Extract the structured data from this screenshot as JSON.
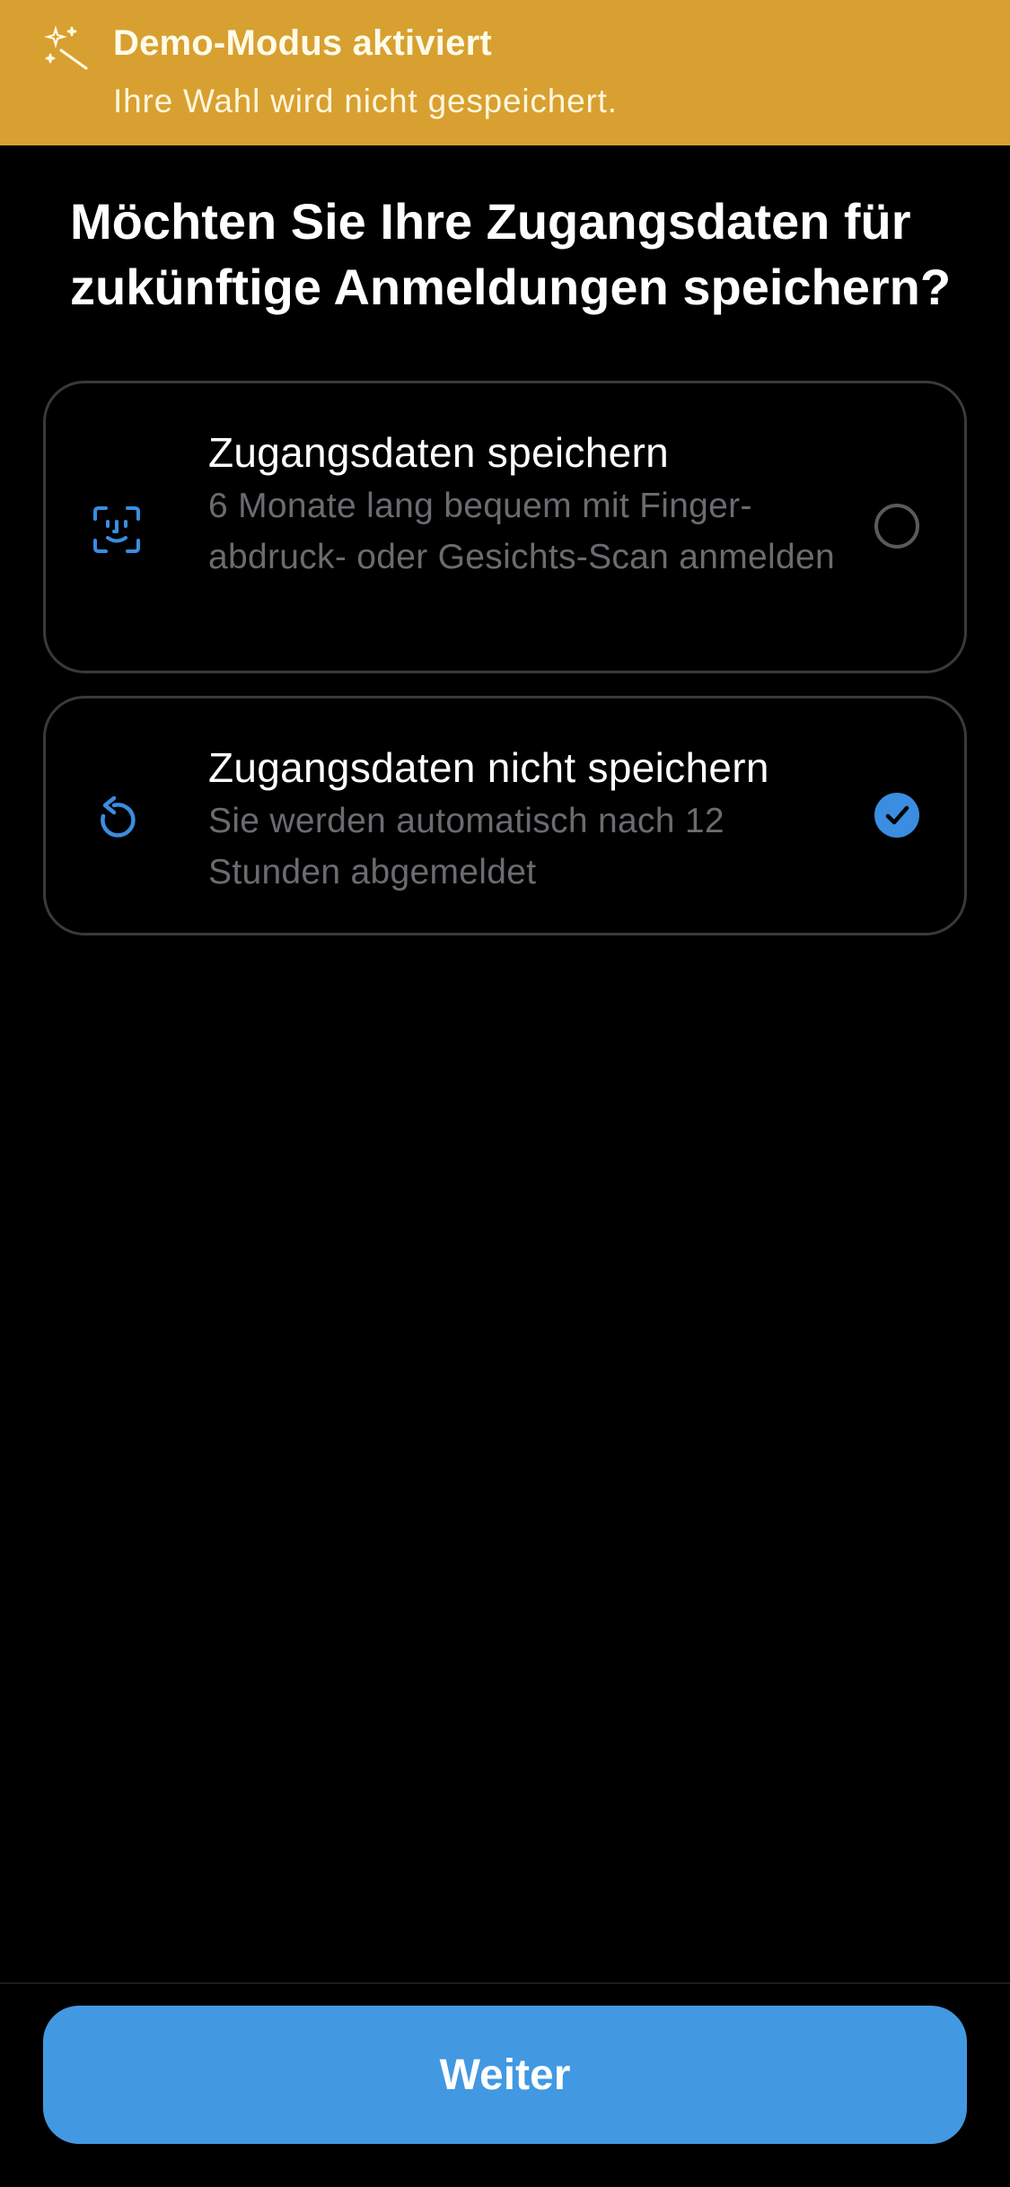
{
  "banner": {
    "icon": "magic-sparkles-icon",
    "title": "Demo-Modus aktiviert",
    "subtitle": "Ihre Wahl wird nicht gespeichert.",
    "color": "#d8a030"
  },
  "question": "Möchten Sie Ihre Zugangsdaten für zukünftige Anmeldungen speichern?",
  "options": [
    {
      "icon": "face-scan-icon",
      "title": "Zugangsdaten speichern",
      "description": "6 Monate lang bequem mit Finger-abdruck- oder Gesichts-Scan anmelden",
      "selected": false
    },
    {
      "icon": "refresh-icon",
      "title": "Zugangsdaten nicht speichern",
      "description": "Sie werden automatisch nach 12 Stunden abgemeldet",
      "selected": true
    }
  ],
  "accent_color": "#4299e1",
  "continue_label": "Weiter"
}
